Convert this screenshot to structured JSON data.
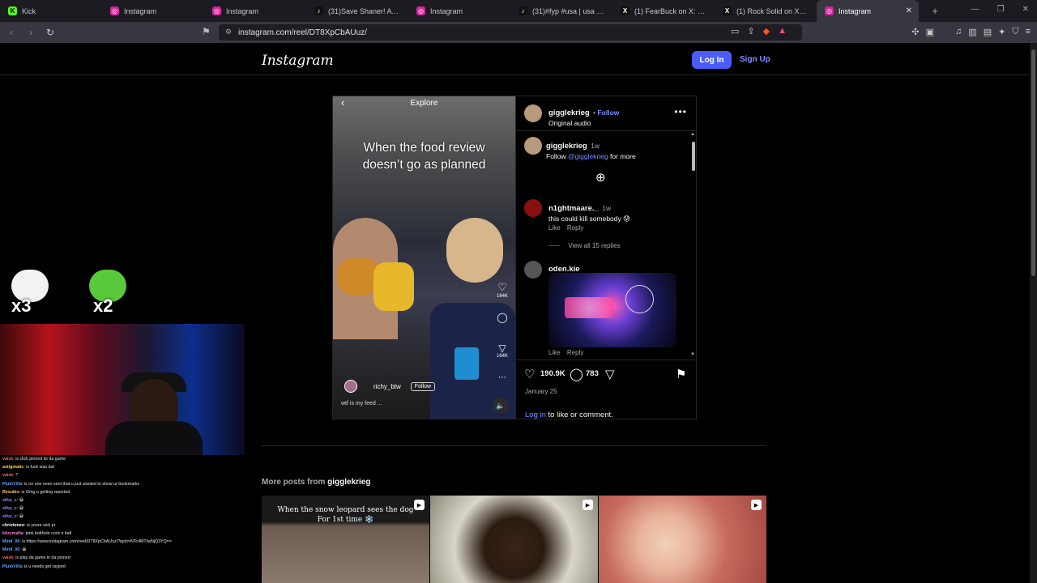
{
  "browser": {
    "tabs": [
      {
        "title": "Kick",
        "icon": "kick-icon",
        "color": "#53fc18",
        "glyph": "K"
      },
      {
        "title": "Instagram",
        "icon": "instagram-icon",
        "color": "#d6249f",
        "glyph": "◎"
      },
      {
        "title": "Instagram",
        "icon": "instagram-icon",
        "color": "#d6249f",
        "glyph": "◎"
      },
      {
        "title": "(31)Save Shaner! A Hearth…",
        "icon": "tiktok-icon",
        "color": "#111111",
        "glyph": "♪"
      },
      {
        "title": "Instagram",
        "icon": "instagram-icon",
        "color": "#d6249f",
        "glyph": "◎"
      },
      {
        "title": "(31)#fyp #usa | usa | TikTo…",
        "icon": "tiktok-icon",
        "color": "#111111",
        "glyph": "♪"
      },
      {
        "title": "(1) FearBuck on X: \"Meta i…",
        "icon": "x-icon",
        "color": "#111111",
        "glyph": "X"
      },
      {
        "title": "(1) Rock Solid on X: \"&gt…",
        "icon": "x-icon",
        "color": "#111111",
        "glyph": "X"
      },
      {
        "title": "Instagram",
        "icon": "instagram-icon",
        "color": "#d6249f",
        "glyph": "◎",
        "active": true
      }
    ],
    "url": "instagram.com/reel/DT8XpCbAUuz/"
  },
  "instagram": {
    "logo": "Instagram",
    "login_label": "Log In",
    "signup_label": "Sign Up",
    "video": {
      "header": "Explore",
      "overlay_line1": "When the food review",
      "overlay_line2": "doesn’t go as planned",
      "like_count": "164K",
      "share_count": "164K",
      "user": "richy_btw",
      "follow_label": "Follow",
      "caption": "wtf is my feed ..."
    },
    "post": {
      "author": "gigglekrieg",
      "follow_label": "Follow",
      "audio": "Original audio",
      "caption_user": "gigglekrieg",
      "caption_time": "1w",
      "caption_prefix": "Follow ",
      "caption_mention": "@gigglekrieg",
      "caption_suffix": " for more"
    },
    "comments": [
      {
        "user": "n1ghtmaare._",
        "time": "1w",
        "text": "this could kill somebody 😰",
        "like": "Like",
        "reply": "Reply",
        "view_replies": "View all 15 replies"
      },
      {
        "user": "oden.kie",
        "like": "Like",
        "reply": "Reply"
      }
    ],
    "actions": {
      "likes": "190.9K",
      "comments": "783",
      "date": "January 25",
      "login_link": "Log in",
      "login_suffix": " to like or comment."
    },
    "more_posts": {
      "prefix": "More posts from ",
      "user": "gigglekrieg",
      "thumbs": [
        {
          "title1": "When the snow leopard sees the dog",
          "title2": "For 1st time ❄️",
          "bg": "#6a5a50"
        },
        {
          "title1": "",
          "title2": "",
          "bg": "#3a2e26"
        },
        {
          "title1": "",
          "title2": "",
          "bg": "#c76a5e"
        }
      ]
    }
  },
  "overlay": {
    "sticker1": "x3",
    "sticker2": "x2",
    "chat": [
      {
        "user": "vaisk",
        "text": ": is click pinned its da game",
        "color": "#ff5f5f"
      },
      {
        "user": "astigmatic",
        "text": ": is fuck was dat",
        "color": "#ffd24a"
      },
      {
        "user": "vaisk",
        "text": ": ?",
        "color": "#ff5f5f"
      },
      {
        "user": "PlutoVilla",
        "text": ": is no one even sent that u just wanted to show ur bookmarks",
        "color": "#59a8ff"
      },
      {
        "user": "Resukio",
        "text": ": is Omg u getting reported",
        "color": "#ffd24a"
      },
      {
        "user": "sllvy_c",
        "text": ": 😀",
        "color": "#a98cff"
      },
      {
        "user": "sllvy_c",
        "text": ": 😀",
        "color": "#a98cff"
      },
      {
        "user": "sllvy_c",
        "text": ": 😀",
        "color": "#a98cff"
      },
      {
        "user": "christoneo",
        "text": ": is youre sick pr",
        "color": "#ffffff"
      },
      {
        "user": "kitzymafia",
        "text": ": pink butthole cock n ball",
        "color": "#ff7de2"
      },
      {
        "user": "Mind_06",
        "text": ": is https://www.instagram.com/reel/DT8XpCbAUuz/?igsh=NTc4MTIwNjQ3YQ==",
        "color": "#59a8ff"
      },
      {
        "user": "Mind_06",
        "text": ": 😀",
        "color": "#59a8ff"
      },
      {
        "user": "vaisk",
        "text": ": is play da game in da pinned",
        "color": "#ff5f5f"
      },
      {
        "user": "PlutoVilla",
        "text": ": is u needs get rayped",
        "color": "#59a8ff"
      }
    ]
  }
}
